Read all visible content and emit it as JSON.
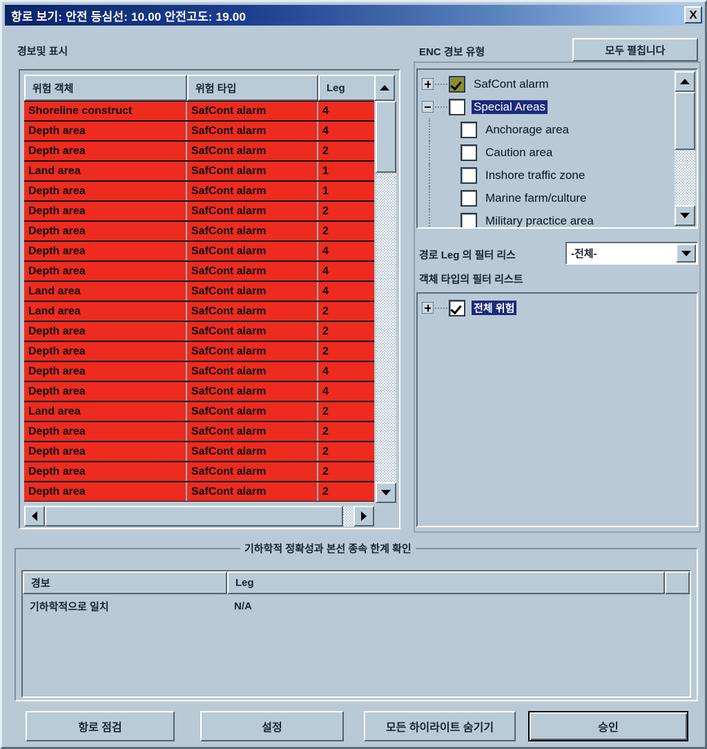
{
  "window": {
    "title": "항로 보기: 안전 등심선: 10.00  안전고도: 19.00",
    "close_label": "X"
  },
  "left_panel": {
    "label": "경보및 표시",
    "columns": [
      "위험 객체",
      "위험 타입",
      "Leg"
    ],
    "rows": [
      [
        "Shoreline construct",
        "SafCont alarm",
        "4"
      ],
      [
        "Depth area",
        "SafCont alarm",
        "4"
      ],
      [
        "Depth area",
        "SafCont alarm",
        "2"
      ],
      [
        "Land area",
        "SafCont alarm",
        "1"
      ],
      [
        "Depth area",
        "SafCont alarm",
        "1"
      ],
      [
        "Depth area",
        "SafCont alarm",
        "2"
      ],
      [
        "Depth area",
        "SafCont alarm",
        "2"
      ],
      [
        "Depth area",
        "SafCont alarm",
        "4"
      ],
      [
        "Depth area",
        "SafCont alarm",
        "4"
      ],
      [
        "Land area",
        "SafCont alarm",
        "4"
      ],
      [
        "Land area",
        "SafCont alarm",
        "2"
      ],
      [
        "Depth area",
        "SafCont alarm",
        "2"
      ],
      [
        "Depth area",
        "SafCont alarm",
        "2"
      ],
      [
        "Depth area",
        "SafCont alarm",
        "4"
      ],
      [
        "Depth area",
        "SafCont alarm",
        "4"
      ],
      [
        "Land area",
        "SafCont alarm",
        "2"
      ],
      [
        "Depth area",
        "SafCont alarm",
        "2"
      ],
      [
        "Depth area",
        "SafCont alarm",
        "2"
      ],
      [
        "Depth area",
        "SafCont alarm",
        "2"
      ],
      [
        "Depth area",
        "SafCont alarm",
        "2"
      ]
    ]
  },
  "right_panel": {
    "enc_label": "ENC 경보 유형",
    "expand_all_label": "모두 펼칩니다",
    "enc_tree": [
      {
        "label": "SafCont alarm",
        "expander": "plus",
        "checkbox": "olive-checked",
        "selected": false,
        "level": 0
      },
      {
        "label": "Special Areas",
        "expander": "minus",
        "checkbox": "unchecked",
        "selected": true,
        "level": 0
      },
      {
        "label": "Anchorage area",
        "expander": "none",
        "checkbox": "unchecked",
        "selected": false,
        "level": 1
      },
      {
        "label": "Caution area",
        "expander": "none",
        "checkbox": "unchecked",
        "selected": false,
        "level": 1
      },
      {
        "label": "Inshore traffic zone",
        "expander": "none",
        "checkbox": "unchecked",
        "selected": false,
        "level": 1
      },
      {
        "label": "Marine farm/culture",
        "expander": "none",
        "checkbox": "unchecked",
        "selected": false,
        "level": 1
      },
      {
        "label": "Military practice area",
        "expander": "none",
        "checkbox": "unchecked",
        "selected": false,
        "level": 1
      }
    ],
    "leg_filter_label": "경로 Leg 의 필터 리스",
    "leg_filter_value": "-전체-",
    "object_filter_label": "객체 타입의 필터 리스트",
    "object_tree": [
      {
        "label": "전체 위험",
        "expander": "plus",
        "checkbox": "checked",
        "selected": true,
        "level": 0
      }
    ]
  },
  "bottom_panel": {
    "group_title": "기하학적 정확성과 본선 종속 한계 확인",
    "columns": [
      "경보",
      "Leg",
      ""
    ],
    "rows": [
      [
        "기하학적으로 일치",
        "N/A"
      ]
    ]
  },
  "buttons": {
    "check_route": "항로 점검",
    "setting": "설정",
    "hide_highlights": "모든 하이라이트 숨기기",
    "ok": "승인"
  },
  "colors": {
    "alarm_row": "#ED2B1F",
    "dialog_face": "#B9C9D6",
    "title_start": "#0A246A",
    "title_end": "#A6CAF0",
    "selection": "#1B2A7A",
    "olive_check": "#8D8C2B"
  }
}
